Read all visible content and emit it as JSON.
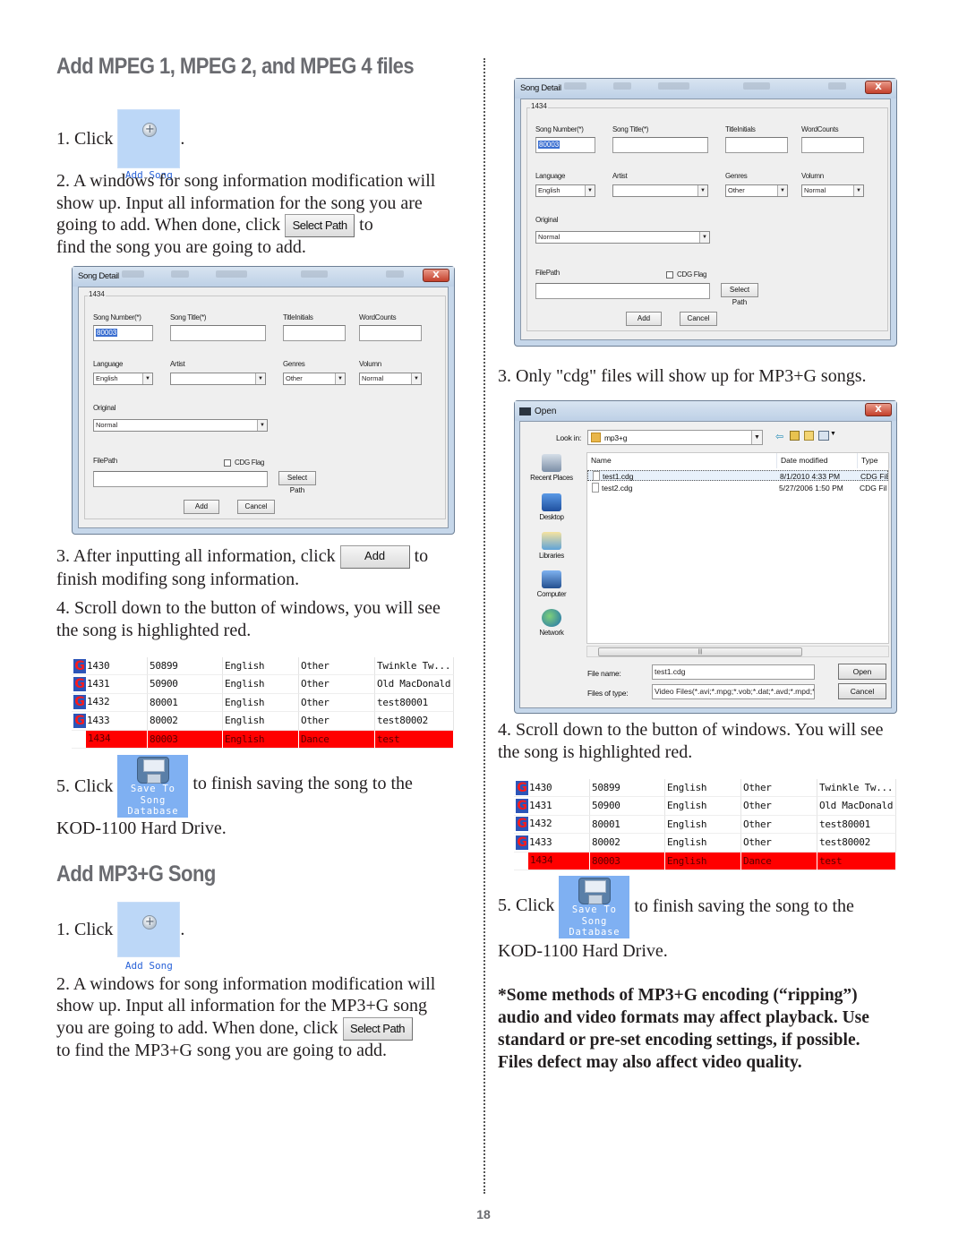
{
  "left": {
    "title": "Add MPEG 1, MPEG 2, and MPEG 4 files",
    "step1_prefix": "1. Click",
    "step1_suffix": ".",
    "step2_line1": "2. A windows for song information modification will",
    "step2_line2": "show up. Input all information for the song you are",
    "step2_line3_prefix": "going to add. When done, click",
    "step2_line3_suffix": "to",
    "step2_line4": "find the song you are going to add.",
    "step3_prefix": "3. After inputting all information, click",
    "step3_suffix": "to",
    "step3_line2": "finish modifing song information.",
    "step4_line1": "4. Scroll down to the button of windows, you will see",
    "step4_line2": "the song is highlighted red.",
    "step5_prefix": "5. Click",
    "step5_suffix": "to finish saving the song to the",
    "step5_line2": "KOD-1100 Hard Drive.",
    "mp3g_title": "Add MP3+G Song",
    "mp3g_step1_prefix": "1. Click",
    "mp3g_step1_suffix": ".",
    "mp3g_step2_line1": "2. A windows for song information modification will",
    "mp3g_step2_line2": "show up. Input all information for the MP3+G song",
    "mp3g_step2_line3_prefix": "you are going to add. When done, click",
    "mp3g_step2_line4": "to find the MP3+G song you are going to add."
  },
  "right": {
    "step3": "3. Only \"cdg\" files will show up for MP3+G songs.",
    "step4_line1": "4. Scroll down to the button of windows. You will see",
    "step4_line2": "the song is highlighted red.",
    "step5_prefix": "5. Click",
    "step5_suffix": "to finish saving the song to the",
    "step5_line2": "KOD-1100 Hard Drive.",
    "note_line1": "*Some methods of MP3+G encoding (“ripping”)",
    "note_line2": "audio and video formats may affect playback. Use",
    "note_line3": "standard or pre-set encoding settings, if possible.",
    "note_line4": "Files defect may also affect video quality."
  },
  "buttons": {
    "add_song": "Add Song",
    "add_song_icon": "plus-circle-icon",
    "save_db_line1": "Save To",
    "save_db_line2": "Song",
    "save_db_line3": "Database",
    "save_db_icon": "floppy-disk-icon",
    "select_path": "Select Path",
    "add": "Add"
  },
  "song_detail": {
    "title": "Song Detail",
    "close": "X",
    "group": "1434",
    "song_number_label": "Song Number(*)",
    "song_number_value": "80003",
    "song_title_label": "Song Title(*)",
    "song_title_value": "",
    "title_initials_label": "TitleInitials",
    "word_counts_label": "WordCounts",
    "language_label": "Language",
    "language_value": "English",
    "artist_label": "Artist",
    "artist_value": "",
    "genres_label": "Genres",
    "genres_value": "Other",
    "volumn_label": "Volumn",
    "volumn_value": "Normal",
    "original_label": "Original",
    "original_value": "Normal",
    "filepath_label": "FilePath",
    "filepath_value": "",
    "cdg_flag_label": "CDG Flag",
    "cdg_flag_checked": false,
    "select_path": "Select Path",
    "add": "Add",
    "cancel": "Cancel"
  },
  "open_dialog": {
    "title": "Open",
    "close": "X",
    "look_in_label": "Look in:",
    "look_in_value": "mp3+g",
    "places": [
      "Recent Places",
      "Desktop",
      "Libraries",
      "Computer",
      "Network"
    ],
    "columns": [
      "Name",
      "Date modified",
      "Type"
    ],
    "files": [
      {
        "name": "test1.cdg",
        "date": "8/1/2010 4:33 PM",
        "type": "CDG Fil",
        "selected": true
      },
      {
        "name": "test2.cdg",
        "date": "5/27/2006 1:50 PM",
        "type": "CDG Fil",
        "selected": false
      }
    ],
    "file_name_label": "File name:",
    "file_name_value": "test1.cdg",
    "files_of_type_label": "Files of type:",
    "files_of_type_value": "Video Files(*.avi;*.mpg;*.vob;*.dat;*.avd;*.mpd;*",
    "open": "Open",
    "cancel": "Cancel"
  },
  "song_table": {
    "rows": [
      {
        "id": "1430",
        "number": "50899",
        "language": "English",
        "genre": "Other",
        "title": "Twinkle Tw...",
        "highlighted": false
      },
      {
        "id": "1431",
        "number": "50900",
        "language": "English",
        "genre": "Other",
        "title": "Old MacDonald",
        "highlighted": false
      },
      {
        "id": "1432",
        "number": "80001",
        "language": "English",
        "genre": "Other",
        "title": "test80001",
        "highlighted": false
      },
      {
        "id": "1433",
        "number": "80002",
        "language": "English",
        "genre": "Other",
        "title": "test80002",
        "highlighted": false
      },
      {
        "id": "1434",
        "number": "80003",
        "language": "English",
        "genre": "Dance",
        "title": "test",
        "highlighted": true
      }
    ],
    "highlight_color": "#ff0000"
  },
  "page_number": "18"
}
